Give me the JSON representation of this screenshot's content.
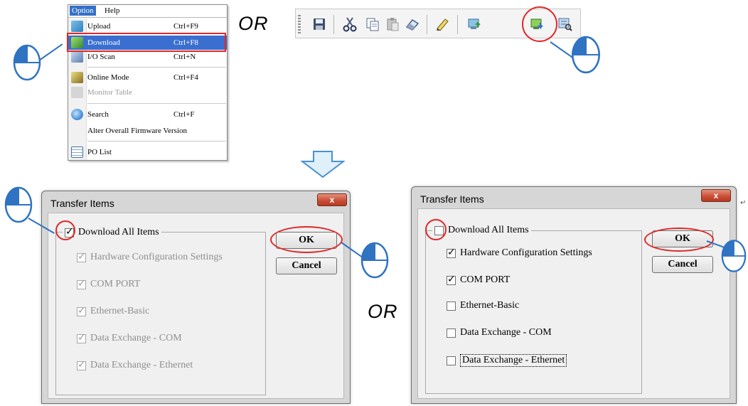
{
  "menu": {
    "bar": {
      "option": "Option",
      "help": "Help"
    },
    "items": [
      {
        "label": "Upload",
        "shortcut": "Ctrl+F9",
        "icon": "upload-icon"
      },
      {
        "label": "Download",
        "shortcut": "Ctrl+F8",
        "icon": "download-icon",
        "selected": true
      },
      {
        "label": "I/O Scan",
        "shortcut": "Ctrl+N",
        "icon": "io-scan-icon"
      },
      {
        "label": "Online Mode",
        "shortcut": "Ctrl+F4",
        "icon": "online-mode-icon"
      },
      {
        "label": "Monitor Table",
        "shortcut": "",
        "icon": "monitor-table-icon",
        "disabled": true
      },
      {
        "label": "Search",
        "shortcut": "Ctrl+F",
        "icon": "search-icon"
      },
      {
        "label": "Alter Overall Firmware Version",
        "shortcut": "",
        "icon": ""
      },
      {
        "label": "PO List",
        "shortcut": "",
        "icon": "po-list-icon"
      }
    ]
  },
  "connectors": {
    "or_top": "OR",
    "or_middle": "OR"
  },
  "toolbar": {
    "icons": [
      "save-icon",
      "cut-icon",
      "copy-icon",
      "paste-icon",
      "eraser-icon",
      "online-mode-icon",
      "upload-icon",
      "download-icon",
      "io-scan-icon"
    ],
    "highlighted": "download-icon"
  },
  "dialog_left": {
    "title": "Transfer Items",
    "close": "x",
    "group_label": "Download All Items",
    "group_checked": true,
    "items": [
      {
        "label": "Hardware Configuration Settings",
        "checked": true
      },
      {
        "label": "COM PORT",
        "checked": true
      },
      {
        "label": "Ethernet-Basic",
        "checked": true
      },
      {
        "label": "Data Exchange - COM",
        "checked": true
      },
      {
        "label": "Data Exchange - Ethernet",
        "checked": true
      }
    ],
    "ok": "OK",
    "cancel": "Cancel"
  },
  "dialog_right": {
    "title": "Transfer Items",
    "close": "x",
    "group_label": "Download All Items",
    "group_checked": false,
    "items": [
      {
        "label": "Hardware Configuration Settings",
        "checked": true
      },
      {
        "label": "COM PORT",
        "checked": true
      },
      {
        "label": "Ethernet-Basic",
        "checked": false
      },
      {
        "label": "Data Exchange - COM",
        "checked": false
      },
      {
        "label": "Data Exchange - Ethernet",
        "checked": false
      }
    ],
    "ok": "OK",
    "cancel": "Cancel"
  },
  "colors": {
    "highlight_red": "#e22626",
    "pointer_blue": "#2f73c2",
    "menu_selection": "#3a6fd0",
    "arrow_fill": "#dff0fb",
    "arrow_stroke": "#4a90d0"
  }
}
